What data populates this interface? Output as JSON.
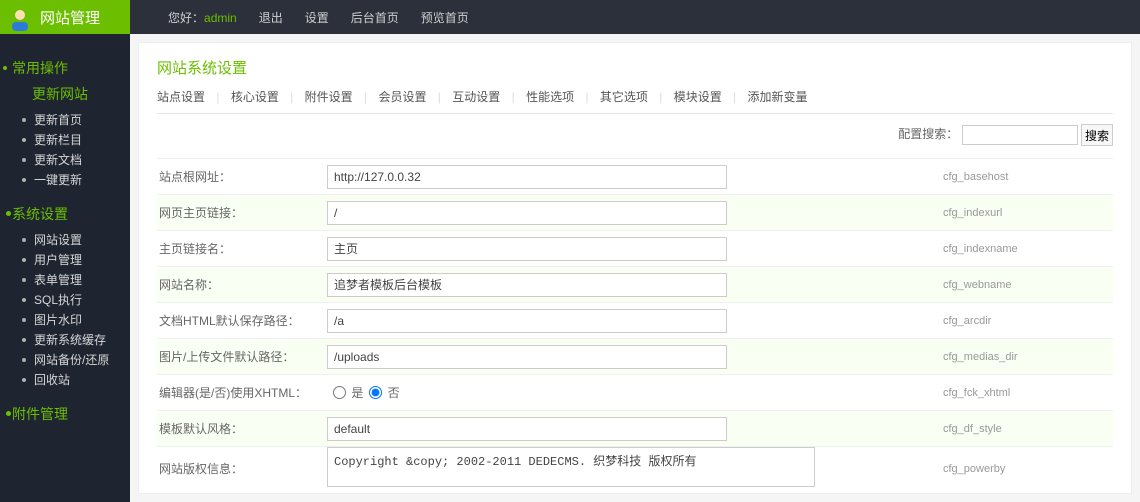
{
  "header": {
    "brand": "网站管理",
    "hello_prefix": "您好：",
    "hello_user": "admin",
    "nav": [
      "退出",
      "设置",
      "后台首页",
      "预览首页"
    ]
  },
  "sidebar": {
    "common_title": "常用操作",
    "common_sub": "更新网站",
    "common_items": [
      "更新首页",
      "更新栏目",
      "更新文档",
      "一键更新"
    ],
    "system_title": "系统设置",
    "system_items": [
      "网站设置",
      "用户管理",
      "表单管理",
      "SQL执行",
      "图片水印",
      "更新系统缓存",
      "网站备份/还原",
      "回收站"
    ],
    "attach_title": "附件管理"
  },
  "page": {
    "title": "网站系统设置",
    "tabs": [
      "站点设置",
      "核心设置",
      "附件设置",
      "会员设置",
      "互动设置",
      "性能选项",
      "其它选项",
      "模块设置",
      "添加新变量"
    ],
    "search_label": "配置搜索：",
    "search_btn": "搜索"
  },
  "rows": [
    {
      "label": "站点根网址：",
      "value": "http://127.0.0.32",
      "var": "cfg_basehost",
      "type": "text"
    },
    {
      "label": "网页主页链接：",
      "value": "/",
      "var": "cfg_indexurl",
      "type": "text"
    },
    {
      "label": "主页链接名：",
      "value": "主页",
      "var": "cfg_indexname",
      "type": "text"
    },
    {
      "label": "网站名称：",
      "value": "追梦者模板后台模板",
      "var": "cfg_webname",
      "type": "text"
    },
    {
      "label": "文档HTML默认保存路径：",
      "value": "/a",
      "var": "cfg_arcdir",
      "type": "text"
    },
    {
      "label": "图片/上传文件默认路径：",
      "value": "/uploads",
      "var": "cfg_medias_dir",
      "type": "text"
    },
    {
      "label": "编辑器(是/否)使用XHTML：",
      "yes": "是",
      "no": "否",
      "var": "cfg_fck_xhtml",
      "type": "radio"
    },
    {
      "label": "模板默认风格：",
      "value": "default",
      "var": "cfg_df_style",
      "type": "text"
    },
    {
      "label": "网站版权信息：",
      "value": "Copyright &copy; 2002-2011 DEDECMS. 织梦科技 版权所有",
      "var": "cfg_powerby",
      "type": "textarea"
    }
  ]
}
